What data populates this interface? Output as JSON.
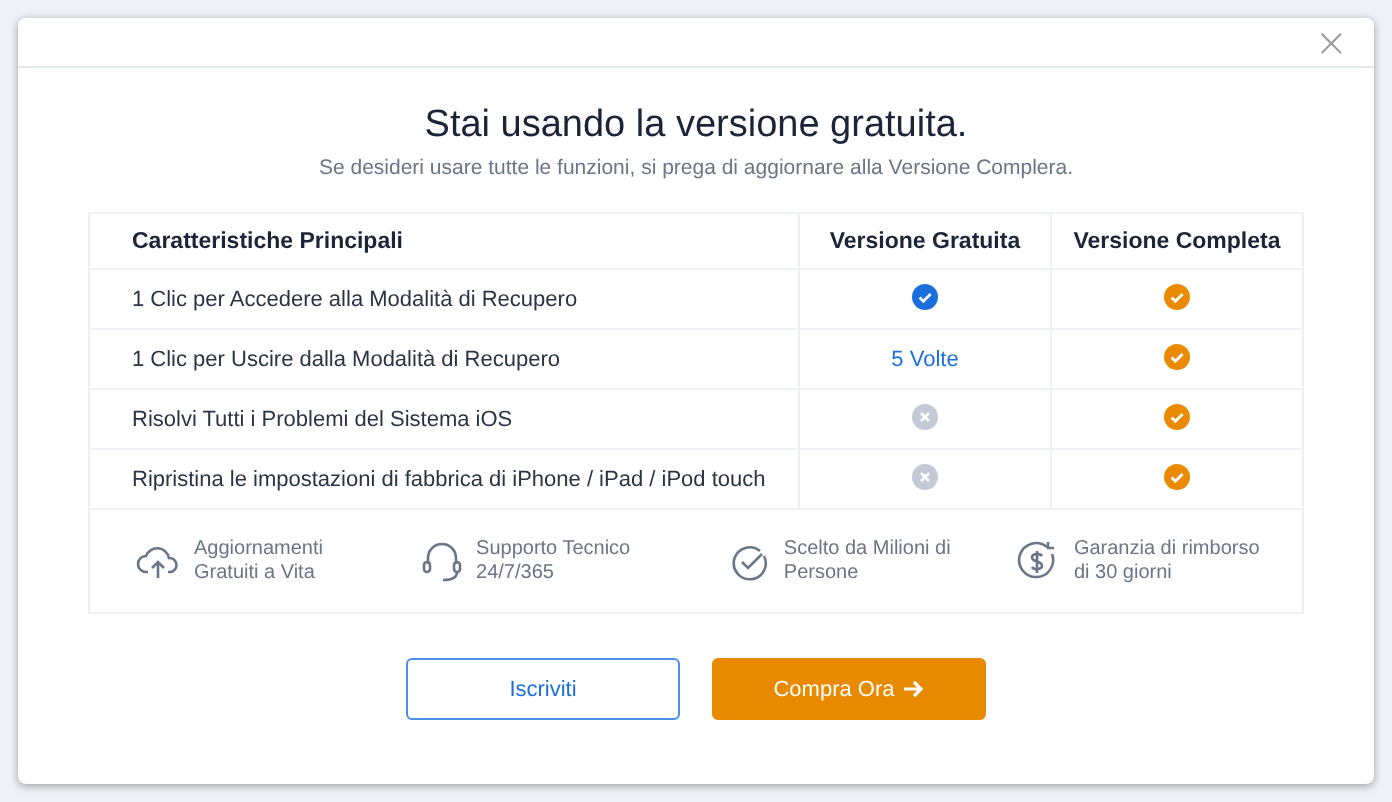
{
  "dialog": {
    "close": "×"
  },
  "heading": {
    "title": "Stai usando la versione gratuita.",
    "subtitle": "Se desideri usare tutte le funzioni, si prega di aggiornare alla Versione Complera."
  },
  "table": {
    "columns": [
      "Caratteristiche Principali",
      "Versione Gratuita",
      "Versione Completa"
    ],
    "rows": [
      {
        "feature": "1 Clic per Accedere alla Modalità di Recupero",
        "free": {
          "kind": "check",
          "color": "#1a6fdc"
        },
        "full": {
          "kind": "check",
          "color": "#ea8a00"
        }
      },
      {
        "feature": "1 Clic per Uscire dalla Modalità di Recupero",
        "free": {
          "kind": "text",
          "text": "5 Volte"
        },
        "full": {
          "kind": "check",
          "color": "#ea8a00"
        }
      },
      {
        "feature": "Risolvi Tutti i Problemi del Sistema iOS",
        "free": {
          "kind": "cross"
        },
        "full": {
          "kind": "check",
          "color": "#ea8a00"
        }
      },
      {
        "feature": "Ripristina le impostazioni di fabbrica di iPhone / iPad / iPod touch",
        "free": {
          "kind": "cross"
        },
        "full": {
          "kind": "check",
          "color": "#ea8a00"
        }
      }
    ]
  },
  "perks": [
    {
      "kind": "cloud",
      "text": "Aggiornamenti Gratuiti a Vita"
    },
    {
      "kind": "headset",
      "text": "Supporto Tecnico 24/7/365"
    },
    {
      "kind": "check",
      "text": "Scelto da Milioni di Persone"
    },
    {
      "kind": "money",
      "text": "Garanzia di rimborso di 30 giorni"
    }
  ],
  "buttons": [
    {
      "kind": "secondary",
      "label": "Iscriviti"
    },
    {
      "kind": "primary",
      "label": "Compra Ora",
      "arrow": true
    }
  ]
}
